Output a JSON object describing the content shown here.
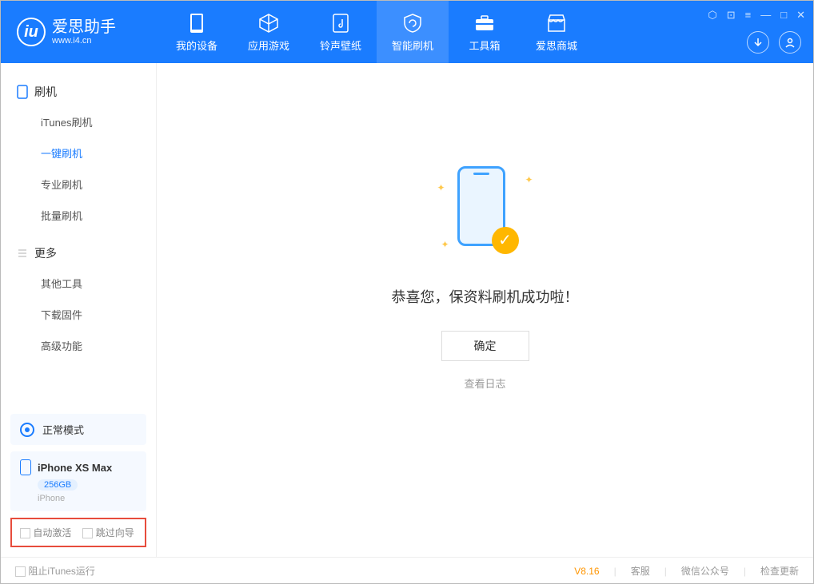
{
  "app": {
    "name": "爱思助手",
    "url": "www.i4.cn"
  },
  "nav": [
    {
      "label": "我的设备"
    },
    {
      "label": "应用游戏"
    },
    {
      "label": "铃声壁纸"
    },
    {
      "label": "智能刷机"
    },
    {
      "label": "工具箱"
    },
    {
      "label": "爱思商城"
    }
  ],
  "sidebar": {
    "section1": {
      "title": "刷机",
      "items": [
        "iTunes刷机",
        "一键刷机",
        "专业刷机",
        "批量刷机"
      ]
    },
    "section2": {
      "title": "更多",
      "items": [
        "其他工具",
        "下载固件",
        "高级功能"
      ]
    }
  },
  "mode": {
    "label": "正常模式"
  },
  "device": {
    "name": "iPhone XS Max",
    "size": "256GB",
    "type": "iPhone"
  },
  "options": {
    "opt1": "自动激活",
    "opt2": "跳过向导"
  },
  "main": {
    "success": "恭喜您，保资料刷机成功啦！",
    "confirm": "确定",
    "log": "查看日志"
  },
  "footer": {
    "block_itunes": "阻止iTunes运行",
    "version": "V8.16",
    "service": "客服",
    "wechat": "微信公众号",
    "update": "检查更新"
  }
}
